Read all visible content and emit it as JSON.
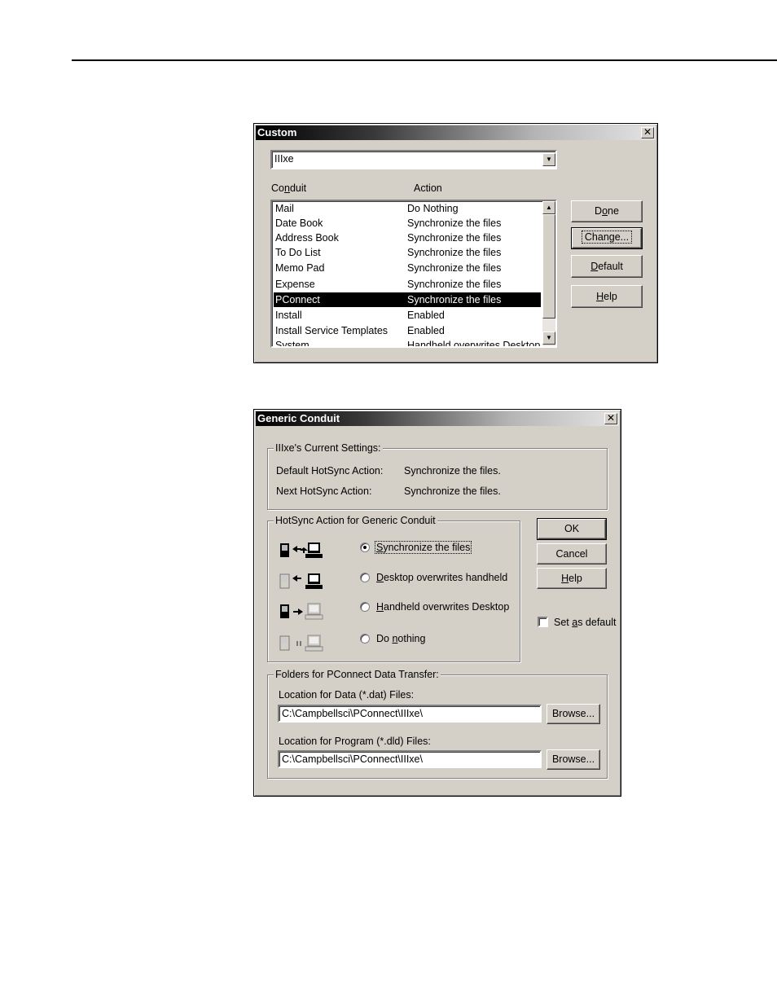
{
  "custom": {
    "title": "Custom",
    "close_glyph": "✕",
    "user_value": "IIIxe",
    "dropdown_glyph": "▼",
    "conduit_header_pre": "Co",
    "conduit_header_key": "n",
    "conduit_header_post": "duit",
    "action_header": "Action",
    "scroll_up_glyph": "▲",
    "scroll_down_glyph": "▼",
    "rows": [
      {
        "conduit": "Mail",
        "action": "Do Nothing"
      },
      {
        "conduit": "Date Book",
        "action": "Synchronize the files"
      },
      {
        "conduit": "Address Book",
        "action": "Synchronize the files"
      },
      {
        "conduit": "To Do List",
        "action": "Synchronize the files"
      },
      {
        "conduit": "Memo Pad",
        "action": "Synchronize the files"
      },
      {
        "conduit": "Expense",
        "action": "Synchronize the files"
      },
      {
        "conduit": "PConnect",
        "action": "Synchronize the files"
      },
      {
        "conduit": "Install",
        "action": "Enabled"
      },
      {
        "conduit": "Install Service Templates",
        "action": "Enabled"
      },
      {
        "conduit": "System",
        "action": "Handheld overwrites Desktop"
      }
    ],
    "selected_row": "PConnect",
    "done_pre": "D",
    "done_key": "o",
    "done_post": "ne",
    "change_label": "Change...",
    "default_key": "D",
    "default_post": "efault",
    "help_key": "H",
    "help_post": "elp"
  },
  "generic": {
    "title": "Generic Conduit",
    "close_glyph": "✕",
    "current_settings_label": "IIIxe's Current Settings:",
    "default_action_label": "Default HotSync Action:",
    "default_action_value": "Synchronize the files.",
    "next_action_label": "Next HotSync Action:",
    "next_action_value": "Synchronize the files.",
    "hotsync_group_label": "HotSync Action for Generic Conduit",
    "options": {
      "sync": {
        "key": "S",
        "post": "ynchronize the files"
      },
      "desktop": {
        "key": "D",
        "post": "esktop overwrites handheld"
      },
      "handheld": {
        "key": "H",
        "post": "andheld overwrites Desktop"
      },
      "nothing": {
        "pre": "Do ",
        "key": "n",
        "post": "othing"
      }
    },
    "selected_option": "sync",
    "ok_label": "OK",
    "cancel_label": "Cancel",
    "help_key": "H",
    "help_post": "elp",
    "set_default_pre": "Set ",
    "set_default_key": "a",
    "set_default_post": "s default",
    "set_default_checked": false,
    "folders_group_label": "Folders for PConnect Data Transfer:",
    "data_location_label": "Location for Data (*.dat) Files:",
    "data_location_value": "C:\\Campbellsci\\PConnect\\IIIxe\\",
    "program_location_label": "Location for Program (*.dld) Files:",
    "program_location_value": "C:\\Campbellsci\\PConnect\\IIIxe\\",
    "browse_label": "Browse..."
  }
}
